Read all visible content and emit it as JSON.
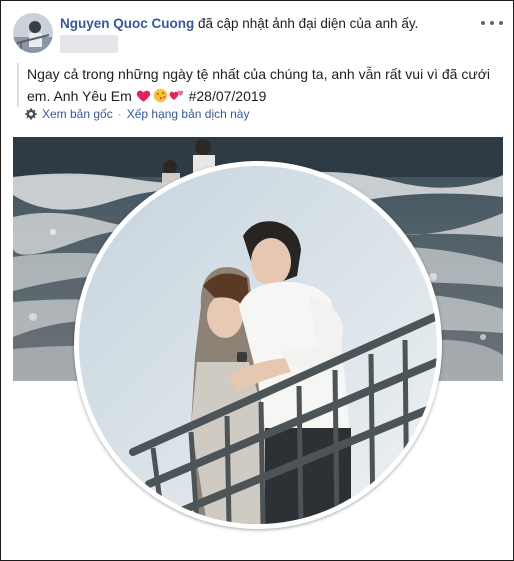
{
  "post": {
    "author": "Nguyen Quoc Cuong",
    "action": " đã cập nhật ảnh đại diện của anh ấy.",
    "text": "Ngay cả trong những ngày tệ nhất của chúng ta, anh vẫn rất vui vì đã cưới em. Anh Yêu Em ",
    "hashtag": " #28/07/2019",
    "emojis": [
      "heart",
      "kissing-face",
      "two-hearts"
    ]
  },
  "translation": {
    "see_original": "Xem bản gốc",
    "separator": "·",
    "rate_translation": "Xếp hạng bản dịch này"
  },
  "colors": {
    "link": "#385898",
    "text": "#1c1e21",
    "heart": "#e0245e"
  },
  "icons": {
    "more": "three-dots-icon",
    "settings": "gear-icon"
  }
}
